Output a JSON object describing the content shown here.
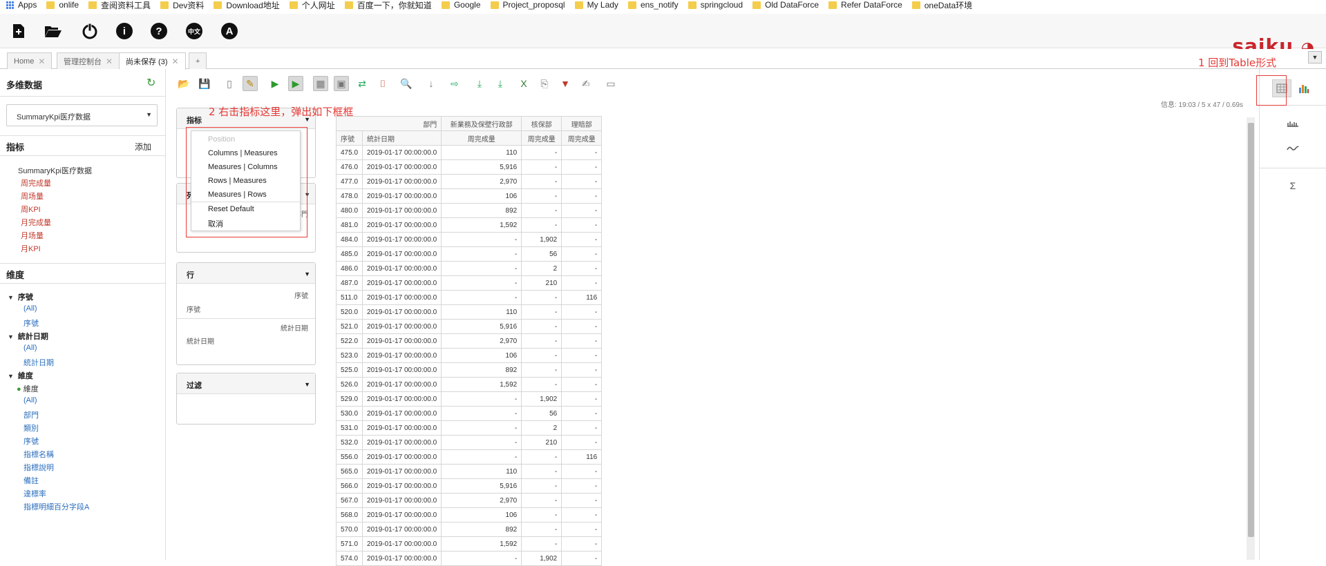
{
  "bookmarks": [
    "Apps",
    "onlife",
    "查阅资料工具",
    "Dev资料",
    "Download地址",
    "个人网址",
    "百度一下，你就知道",
    "Google",
    "Project_proposql",
    "My Lady",
    "ens_notify",
    "springcloud",
    "Old DataForce",
    "Refer DataForce",
    "oneData环境"
  ],
  "logo": "saiku",
  "tabs": [
    "Home",
    "管理控制台",
    "尚未保存 (3)",
    "+"
  ],
  "sidebar": {
    "title": "多维数据",
    "cube": "SummaryKpi医疗数据",
    "measures_title": "指标",
    "add": "添加",
    "measure_group": "SummaryKpi医疗数据",
    "measures": [
      "周完成量",
      "周场量",
      "周KPI",
      "月完成量",
      "月场量",
      "月KPI"
    ],
    "dimensions_title": "维度",
    "dims": [
      {
        "name": "序號",
        "items": [
          "(All)",
          "序號"
        ]
      },
      {
        "name": "統計日期",
        "items": [
          "(All)",
          "統計日期"
        ]
      },
      {
        "name": "維度",
        "sub": "維度",
        "items": [
          "(All)",
          "部門",
          "類別",
          "序號",
          "指標名稱",
          "指標說明",
          "備註",
          "達標率",
          "指標明細百分字段A"
        ]
      }
    ]
  },
  "panels": {
    "measures": "指标",
    "columns": "列",
    "rows": "行",
    "filter": "过滤",
    "col_item": "部門",
    "row_items": [
      "序號",
      "統計日期"
    ]
  },
  "context_menu": [
    "Position",
    "Columns | Measures",
    "Measures | Columns",
    "Rows | Measures",
    "Measures | Rows",
    "Reset Default",
    "取消"
  ],
  "annotations": {
    "a1": "1 回到Table形式",
    "a2": "2 右击指标这里，弹出如下框框"
  },
  "info": "信息:   19:03  /  5 x 47  /  0.69s",
  "table": {
    "top_header": [
      "部門",
      "新業務及保壁行政部",
      "核保部",
      "理賠部"
    ],
    "sub_header": [
      "序號",
      "統計日期",
      "周完成量",
      "周完成量",
      "周完成量"
    ],
    "rows": [
      [
        "475.0",
        "2019-01-17 00:00:00.0",
        "110",
        "-",
        "-"
      ],
      [
        "476.0",
        "2019-01-17 00:00:00.0",
        "5,916",
        "-",
        "-"
      ],
      [
        "477.0",
        "2019-01-17 00:00:00.0",
        "2,970",
        "-",
        "-"
      ],
      [
        "478.0",
        "2019-01-17 00:00:00.0",
        "106",
        "-",
        "-"
      ],
      [
        "480.0",
        "2019-01-17 00:00:00.0",
        "892",
        "-",
        "-"
      ],
      [
        "481.0",
        "2019-01-17 00:00:00.0",
        "1,592",
        "-",
        "-"
      ],
      [
        "484.0",
        "2019-01-17 00:00:00.0",
        "-",
        "1,902",
        "-"
      ],
      [
        "485.0",
        "2019-01-17 00:00:00.0",
        "-",
        "56",
        "-"
      ],
      [
        "486.0",
        "2019-01-17 00:00:00.0",
        "-",
        "2",
        "-"
      ],
      [
        "487.0",
        "2019-01-17 00:00:00.0",
        "-",
        "210",
        "-"
      ],
      [
        "511.0",
        "2019-01-17 00:00:00.0",
        "-",
        "-",
        "116"
      ],
      [
        "520.0",
        "2019-01-17 00:00:00.0",
        "110",
        "-",
        "-"
      ],
      [
        "521.0",
        "2019-01-17 00:00:00.0",
        "5,916",
        "-",
        "-"
      ],
      [
        "522.0",
        "2019-01-17 00:00:00.0",
        "2,970",
        "-",
        "-"
      ],
      [
        "523.0",
        "2019-01-17 00:00:00.0",
        "106",
        "-",
        "-"
      ],
      [
        "525.0",
        "2019-01-17 00:00:00.0",
        "892",
        "-",
        "-"
      ],
      [
        "526.0",
        "2019-01-17 00:00:00.0",
        "1,592",
        "-",
        "-"
      ],
      [
        "529.0",
        "2019-01-17 00:00:00.0",
        "-",
        "1,902",
        "-"
      ],
      [
        "530.0",
        "2019-01-17 00:00:00.0",
        "-",
        "56",
        "-"
      ],
      [
        "531.0",
        "2019-01-17 00:00:00.0",
        "-",
        "2",
        "-"
      ],
      [
        "532.0",
        "2019-01-17 00:00:00.0",
        "-",
        "210",
        "-"
      ],
      [
        "556.0",
        "2019-01-17 00:00:00.0",
        "-",
        "-",
        "116"
      ],
      [
        "565.0",
        "2019-01-17 00:00:00.0",
        "110",
        "-",
        "-"
      ],
      [
        "566.0",
        "2019-01-17 00:00:00.0",
        "5,916",
        "-",
        "-"
      ],
      [
        "567.0",
        "2019-01-17 00:00:00.0",
        "2,970",
        "-",
        "-"
      ],
      [
        "568.0",
        "2019-01-17 00:00:00.0",
        "106",
        "-",
        "-"
      ],
      [
        "570.0",
        "2019-01-17 00:00:00.0",
        "892",
        "-",
        "-"
      ],
      [
        "571.0",
        "2019-01-17 00:00:00.0",
        "1,592",
        "-",
        "-"
      ],
      [
        "574.0",
        "2019-01-17 00:00:00.0",
        "-",
        "1,902",
        "-"
      ]
    ]
  }
}
